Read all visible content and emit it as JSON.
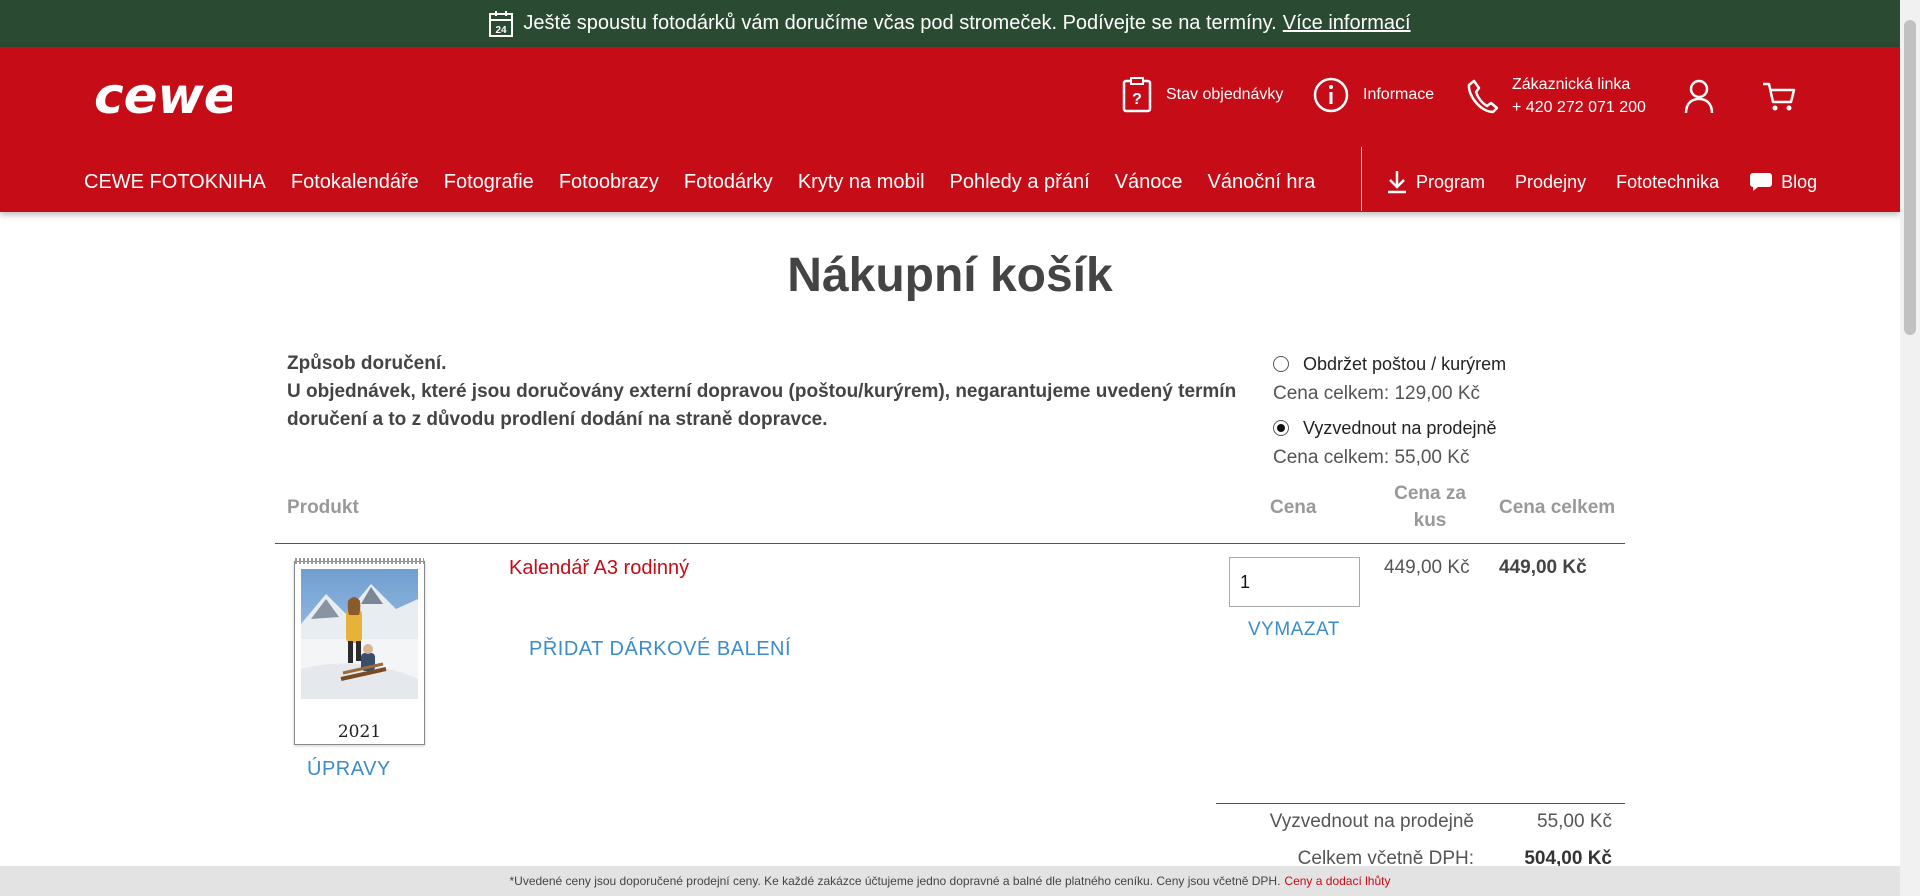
{
  "banner": {
    "text": "Ještě spoustu fotodárků vám doručíme včas pod stromeček. Podívejte se na termíny.",
    "link": "Více informací",
    "calendar_day": "24"
  },
  "header": {
    "logo_text": "cewe",
    "utility": {
      "order_status": "Stav objednávky",
      "info": "Informace",
      "hotline_label": "Zákaznická linka",
      "hotline_number": "+ 420 272 071 200"
    },
    "nav": [
      "CEWE FOTOKNIHA",
      "Fotokalendáře",
      "Fotografie",
      "Fotoobrazy",
      "Fotodárky",
      "Kryty na mobil",
      "Pohledy a přání",
      "Vánoce",
      "Vánoční hra"
    ],
    "nav_right": {
      "program": "Program",
      "stores": "Prodejny",
      "phototech": "Fototechnika",
      "blog": "Blog"
    }
  },
  "cart": {
    "title": "Nákupní košík",
    "delivery": {
      "heading": "Způsob doručení.",
      "note": "U objednávek, které jsou doručovány externí dopravou (poštou/kurýrem), negarantujeme uvedený termín doručení a to z důvodu prodlení dodání na straně dopravce.",
      "options": [
        {
          "label": "Obdržet poštou / kurýrem",
          "price": "Cena celkem: 129,00 Kč",
          "selected": false
        },
        {
          "label": "Vyzvednout na prodejně",
          "price": "Cena celkem: 55,00 Kč",
          "selected": true
        }
      ]
    },
    "columns": {
      "product": "Produkt",
      "price": "Cena",
      "unit_price_1": "Cena za",
      "unit_price_2": "kus",
      "total": "Cena celkem"
    },
    "item": {
      "image_year": "2021",
      "edit": "ÚPRAVY",
      "name": "Kalendář A3 rodinný",
      "gift_wrap": "PŘIDAT DÁRKOVÉ BALENÍ",
      "quantity": "1",
      "delete": "VYMAZAT",
      "unit_price": "449,00 Kč",
      "total_price": "449,00 Kč"
    },
    "summary": {
      "shipping_label": "Vyzvednout na prodejně",
      "shipping_value": "55,00 Kč",
      "total_label": "Celkem včetně DPH:",
      "total_value": "504,00 Kč"
    }
  },
  "footer": {
    "note": "*Uvedené ceny jsou doporučené prodejní ceny. Ke každé zakázce účtujeme jedno dopravné a balné dle platného ceníku. Ceny jsou včetně DPH.",
    "link": "Ceny a dodací lhůty"
  },
  "colors": {
    "brand_red": "#c50c17",
    "banner_green": "#2b4a32",
    "link_blue": "#3b8cc9"
  }
}
